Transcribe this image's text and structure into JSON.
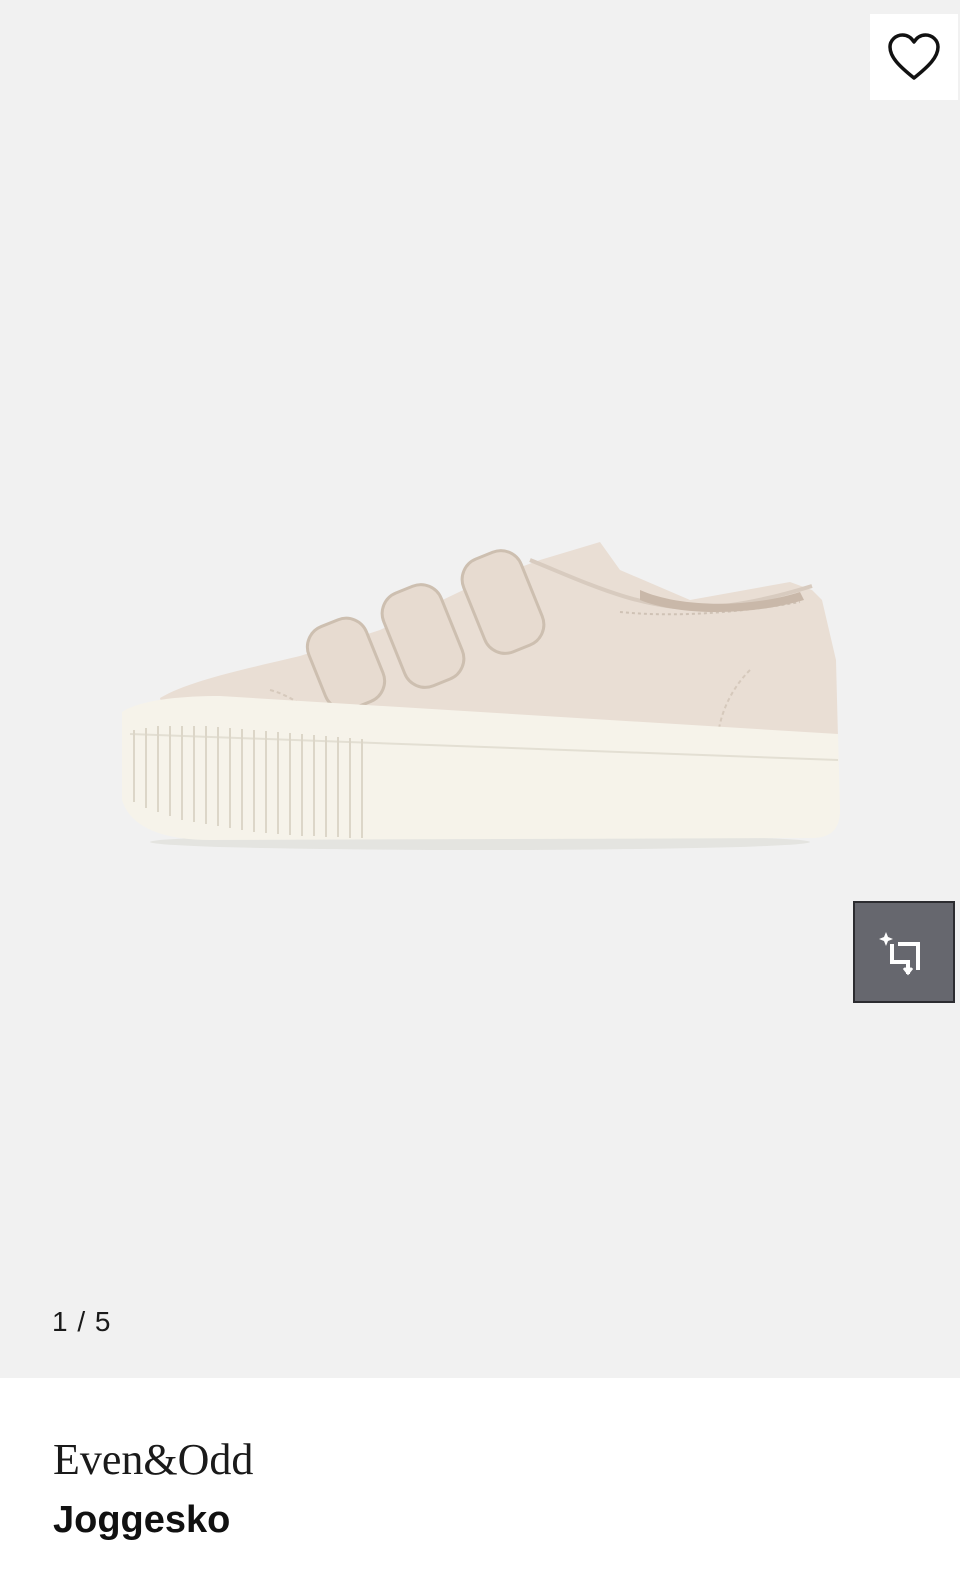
{
  "gallery": {
    "image_alt": "Beige canvas sneaker with three velcro straps and white ribbed sole",
    "pager": {
      "current": "1",
      "separator": "/",
      "total": "5"
    },
    "wishlist_icon": "heart-outline-icon",
    "share_icon": "share-sparkle-icon"
  },
  "product": {
    "brand": "Even&Odd",
    "name": "Joggesko"
  },
  "colors": {
    "gallery_bg": "#f1f1f1",
    "share_button_bg": "#66676e",
    "text": "#1a1a1a"
  }
}
